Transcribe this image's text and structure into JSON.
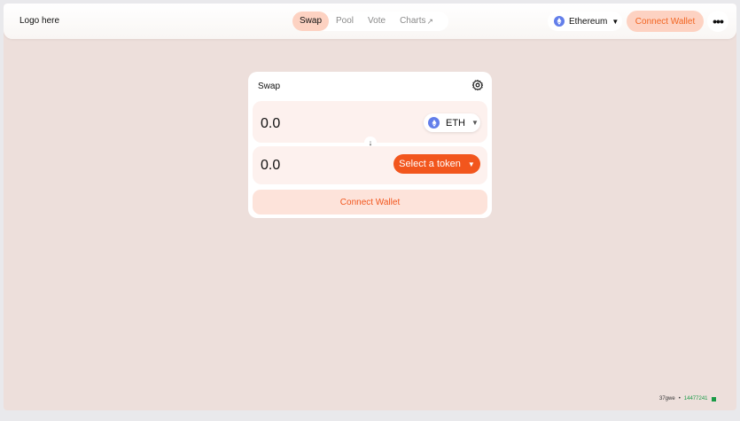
{
  "header": {
    "logo": "Logo here",
    "nav": [
      {
        "label": "Swap",
        "active": true
      },
      {
        "label": "Pool",
        "active": false
      },
      {
        "label": "Vote",
        "active": false
      },
      {
        "label": "Charts",
        "active": false,
        "external_icon": "arrow-up-right-icon"
      }
    ],
    "network": {
      "label": "Ethereum",
      "icon": "ethereum-icon"
    },
    "connect_label": "Connect Wallet",
    "more_icon": "more-dots-icon"
  },
  "swap": {
    "title": "Swap",
    "settings_icon": "gear-icon",
    "input": {
      "amount": "0.0",
      "token": "ETH"
    },
    "output": {
      "amount": "0.0",
      "select_label": "Select a token"
    },
    "switch_icon": "arrow-down-icon",
    "connect_label": "Connect Wallet"
  },
  "status": {
    "gas": "37gwe",
    "block": "14477241"
  },
  "colors": {
    "accent": "#f2561d",
    "accent_soft": "#fdd2c2",
    "background": "#eddfdb",
    "eth": "#627eea",
    "status_ok": "#1a9b47"
  }
}
